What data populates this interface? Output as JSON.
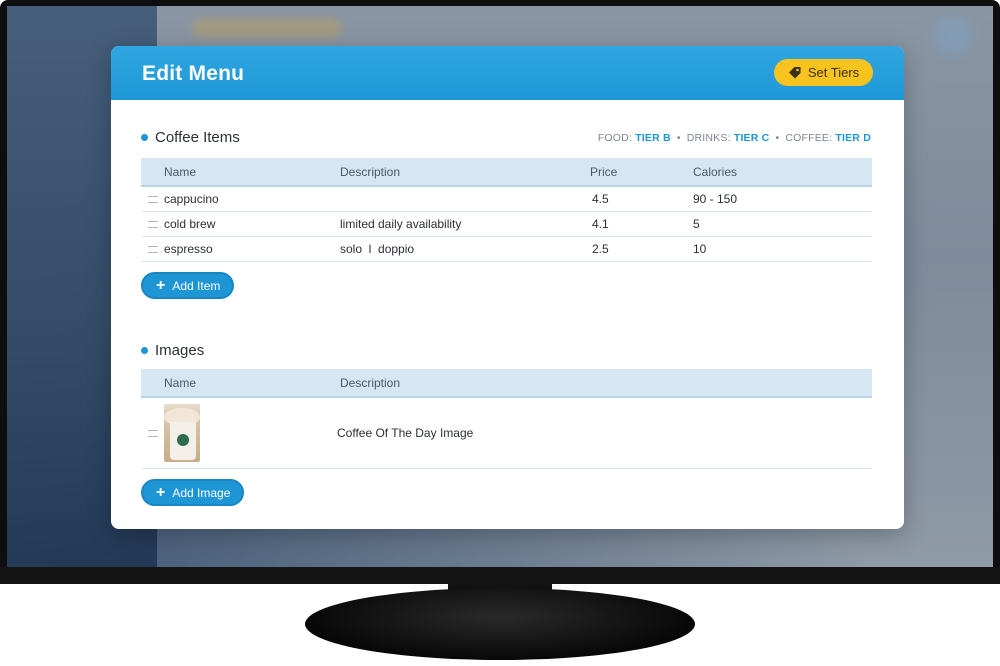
{
  "modal": {
    "title": "Edit Menu",
    "set_tiers_label": "Set Tiers"
  },
  "coffee": {
    "section_title": "Coffee Items",
    "tiers": {
      "food_label": "FOOD:",
      "food_value": "TIER B",
      "drinks_label": "DRINKS:",
      "drinks_value": "TIER C",
      "coffee_label": "COFFEE:",
      "coffee_value": "TIER D",
      "separator": "•"
    },
    "columns": {
      "name": "Name",
      "description": "Description",
      "price": "Price",
      "calories": "Calories"
    },
    "rows": [
      {
        "name": "cappucino",
        "description": "",
        "price": "4.5",
        "calories": "90 - 150"
      },
      {
        "name": "cold brew",
        "description": "limited daily availability",
        "price": "4.1",
        "calories": "5"
      },
      {
        "name": "espresso",
        "description": "solo  l  doppio",
        "price": "2.5",
        "calories": "10"
      }
    ],
    "add_label": "Add Item"
  },
  "images": {
    "section_title": "Images",
    "columns": {
      "name": "Name",
      "description": "Description"
    },
    "rows": [
      {
        "description": "Coffee Of The Day Image"
      }
    ],
    "add_label": "Add Image"
  },
  "colors": {
    "header_blue": "#1f98d8",
    "accent_blue": "#1e96d6",
    "tiers_button": "#f7c31e",
    "table_header_bg": "#d6e7f3"
  },
  "icons": {
    "tiers_button": "tag-icon",
    "add_button": "plus-icon",
    "row_handle": "drag-handle-icon"
  }
}
